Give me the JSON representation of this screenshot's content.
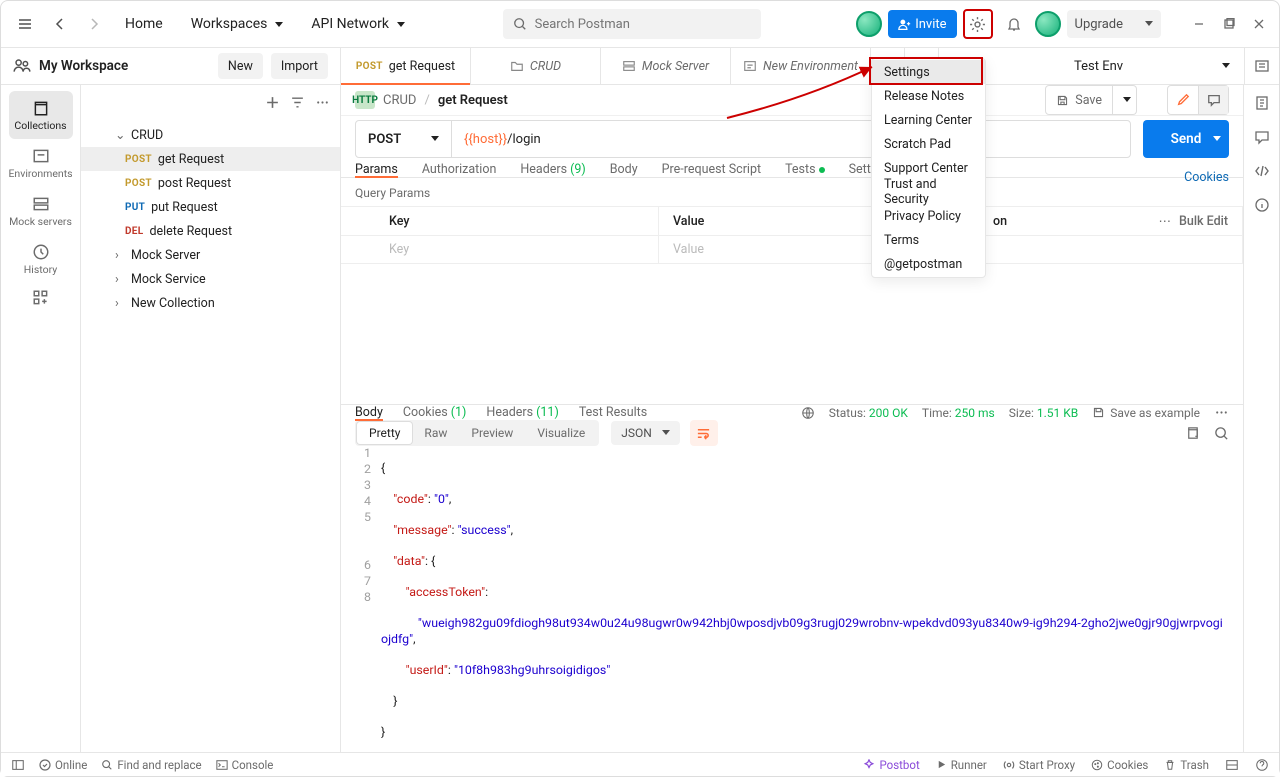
{
  "header": {
    "home": "Home",
    "workspaces": "Workspaces",
    "api_network": "API Network",
    "search_placeholder": "Search Postman",
    "invite": "Invite",
    "upgrade": "Upgrade"
  },
  "workspace": {
    "title": "My Workspace",
    "new_btn": "New",
    "import_btn": "Import",
    "env_name": "Test Env"
  },
  "tabs": [
    {
      "method": "POST",
      "label": "get Request",
      "active": true,
      "icon": "http"
    },
    {
      "label": "CRUD",
      "icon": "folder"
    },
    {
      "label": "Mock Server",
      "icon": "mock"
    },
    {
      "label": "New Environment",
      "icon": "env"
    }
  ],
  "far_nav": [
    {
      "id": "collections",
      "label": "Collections",
      "active": true
    },
    {
      "id": "environments",
      "label": "Environments"
    },
    {
      "id": "mock",
      "label": "Mock servers"
    },
    {
      "id": "history",
      "label": "History"
    }
  ],
  "tree": {
    "root": "CRUD",
    "children": [
      {
        "method": "POST",
        "label": "get Request",
        "selected": true
      },
      {
        "method": "POST",
        "label": "post Request"
      },
      {
        "method": "PUT",
        "label": "put Request"
      },
      {
        "method": "DEL",
        "label": "delete Request"
      }
    ],
    "siblings": [
      "Mock Server",
      "Mock Service",
      "New Collection"
    ]
  },
  "breadcrumb": {
    "collection": "CRUD",
    "request": "get Request",
    "save": "Save"
  },
  "request": {
    "method": "POST",
    "url_var": "{{host}}",
    "url_path": "/login",
    "send": "Send"
  },
  "req_tabs": {
    "params": "Params",
    "auth": "Authorization",
    "headers": "Headers",
    "headers_count": "(9)",
    "body": "Body",
    "prerequest": "Pre-request Script",
    "tests": "Tests",
    "settings": "Settings",
    "cookies": "Cookies"
  },
  "query_params": {
    "title": "Query Params",
    "key_h": "Key",
    "val_h": "Value",
    "desc_h": "on",
    "key_ph": "Key",
    "val_ph": "Value",
    "bulk": "Bulk Edit"
  },
  "response": {
    "tabs": {
      "body": "Body",
      "cookies": "Cookies",
      "cookies_count": "(1)",
      "headers": "Headers",
      "headers_count": "(11)",
      "tests": "Test Results"
    },
    "meta": {
      "status_l": "Status:",
      "status_v": "200 OK",
      "time_l": "Time:",
      "time_v": "250 ms",
      "size_l": "Size:",
      "size_v": "1.51 KB",
      "save_example": "Save as example"
    },
    "views": {
      "pretty": "Pretty",
      "raw": "Raw",
      "preview": "Preview",
      "visualize": "Visualize",
      "type": "JSON"
    },
    "json": {
      "code": "\"0\"",
      "message": "\"success\"",
      "accessToken": "\"wueigh982gu09fdiogh98ut934w0u24u98ugwr0w942hbj0wposdjvb09g3rugj029wrobnv-wpekdvd093yu8340w9-ig9h294-2gho2jwe0gjr90gjwrpvogiojdfg\"",
      "userId": "\"10f8h983hg9uhrsoigidigos\""
    }
  },
  "settings_menu": [
    "Settings",
    "Release Notes",
    "Learning Center",
    "Scratch Pad",
    "Support Center",
    "Trust and Security",
    "Privacy Policy",
    "Terms",
    "@getpostman"
  ],
  "statusbar": {
    "online": "Online",
    "find": "Find and replace",
    "console": "Console",
    "postbot": "Postbot",
    "runner": "Runner",
    "proxy": "Start Proxy",
    "cookies": "Cookies",
    "trash": "Trash"
  }
}
